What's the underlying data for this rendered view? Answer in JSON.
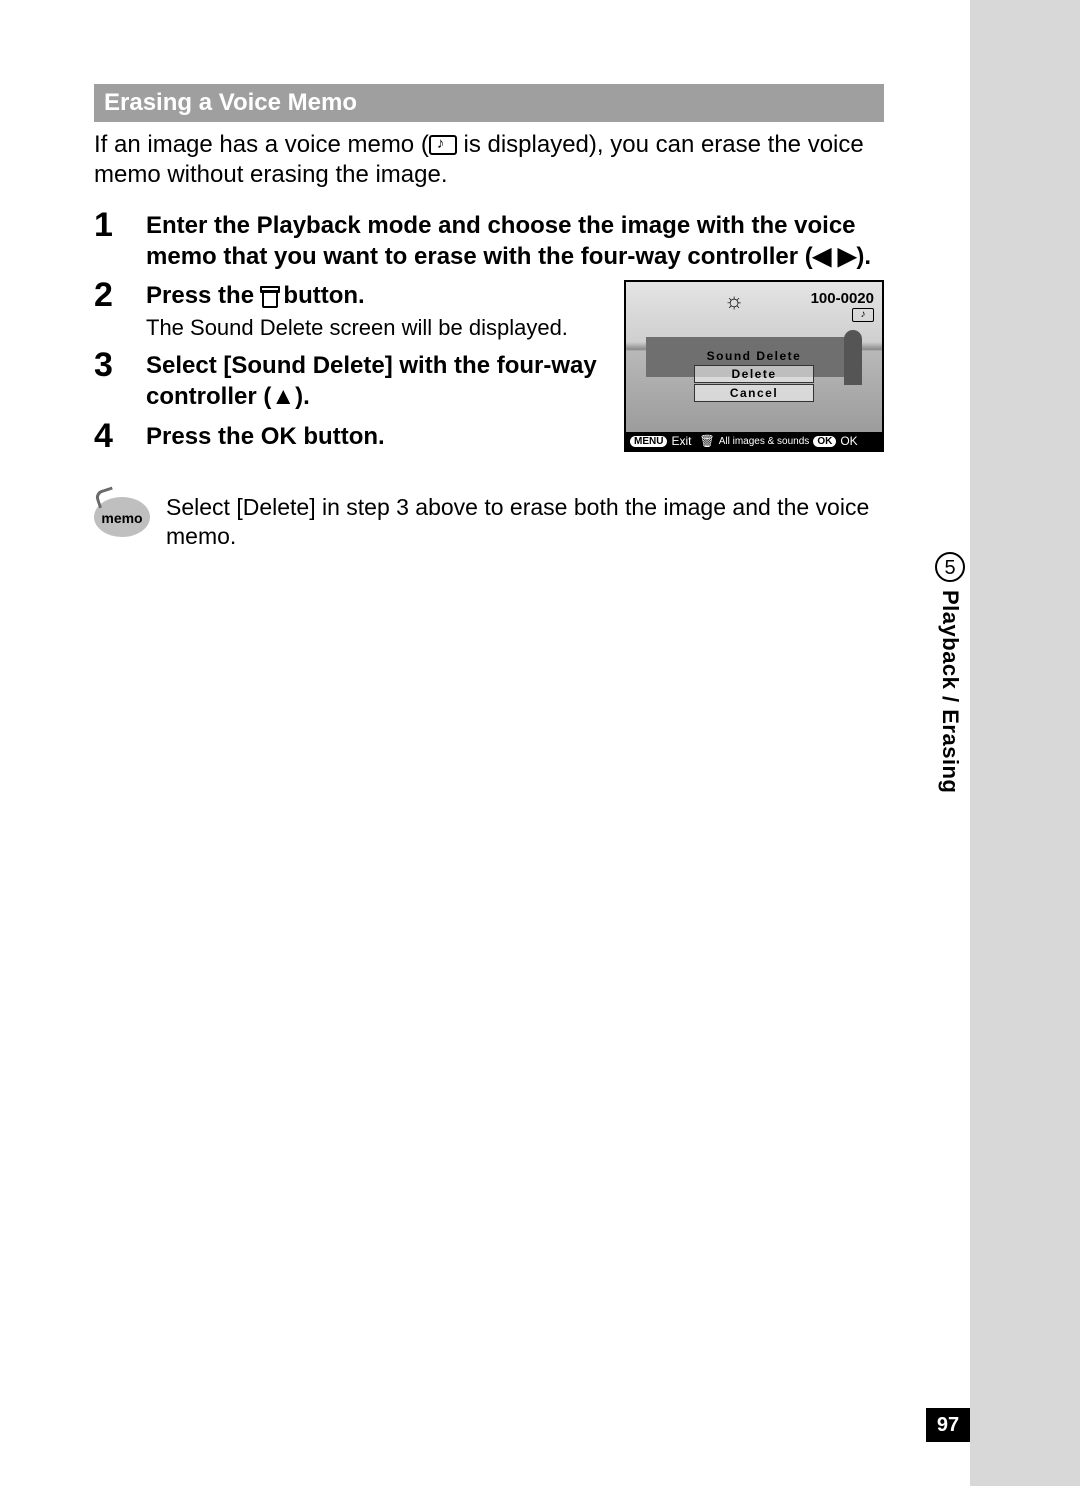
{
  "header": "Erasing a Voice Memo",
  "intro_before": "If an image has a voice memo (",
  "intro_after": " is displayed), you can erase the voice memo without erasing the image.",
  "steps": {
    "s1_num": "1",
    "s1_title": "Enter the Playback mode and choose the image with the voice memo that you want to erase with the four-way controller (◀ ▶).",
    "s2_num": "2",
    "s2_title_before": "Press the ",
    "s2_title_after": " button.",
    "s2_desc": "The Sound Delete screen will be displayed.",
    "s3_num": "3",
    "s3_title": "Select [Sound Delete] with the four-way controller (▲).",
    "s4_num": "4",
    "s4_title": "Press the OK button."
  },
  "lcd": {
    "image_id": "100-0020",
    "menu": [
      "Sound Delete",
      "Delete",
      "Cancel"
    ],
    "bottom_menu_badge": "MENU",
    "bottom_exit": "Exit",
    "bottom_all": "All images & sounds",
    "bottom_ok_badge": "OK",
    "bottom_ok": "OK"
  },
  "memo": {
    "label": "memo",
    "text": "Select [Delete] in step 3 above to erase both the image and the voice memo."
  },
  "side": {
    "chapter_num": "5",
    "chapter_label": "Playback / Erasing"
  },
  "page_number": "97"
}
